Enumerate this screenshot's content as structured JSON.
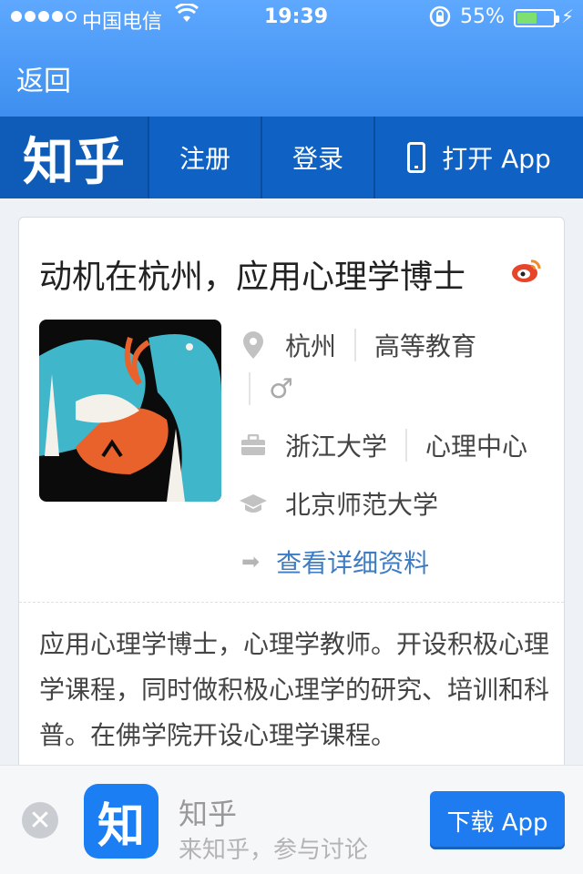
{
  "status_bar": {
    "carrier": "中国电信",
    "time": "19:39",
    "battery_text": "55%",
    "battery_level": 0.55,
    "signal_bars_filled": 4,
    "signal_bars_total": 5
  },
  "header": {
    "back_label": "返回"
  },
  "nav": {
    "logo": "知乎",
    "register": "注册",
    "login": "登录",
    "open_app": "打开 App"
  },
  "profile": {
    "title": "动机在杭州，应用心理学博士",
    "location": "杭州",
    "industry": "高等教育",
    "gender_symbol": "♂",
    "company": "浙江大学",
    "position": "心理中心",
    "school": "北京师范大学",
    "detail_link": "查看详细资料",
    "bio": "应用心理学博士，心理学教师。开设积极心理学课程，同时做积极心理学的研究、培训和科普。在佛学院开设心理学课程。"
  },
  "banner": {
    "app_icon_char": "知",
    "app_name": "知乎",
    "app_sub": "来知乎，参与讨论",
    "download": "下载 App"
  },
  "colors": {
    "header_blue": "#4d9bf8",
    "nav_blue": "#0e5cb8",
    "link_blue": "#3e7cc4",
    "button_blue": "#1f7cf0",
    "weibo_red": "#e6452a"
  }
}
